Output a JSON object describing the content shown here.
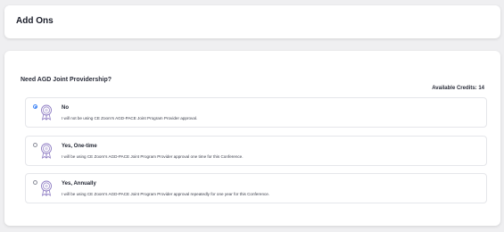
{
  "header": {
    "title": "Add Ons"
  },
  "addon": {
    "question": "Need AGD Joint Providership?",
    "credits": "Available Credits: 14",
    "options": [
      {
        "title": "No",
        "description": "I will not be using CE Zoom's AGD-PACE Joint Program Provider approval.",
        "selected": true
      },
      {
        "title": "Yes, One-time",
        "description": "I will be using CE Zoom's AGD-PACE Joint Program Provider approval one time for this Conference.",
        "selected": false
      },
      {
        "title": "Yes, Annually",
        "description": "I will be using CE Zoom's AGD-PACE Joint Program Provider approval repeatedly for one year for this Conference.",
        "selected": false
      }
    ]
  },
  "colors": {
    "accent": "#3b82f6",
    "badge": "#8e7cc3"
  },
  "icons": {
    "option_icon": "award-ribbon-icon"
  }
}
